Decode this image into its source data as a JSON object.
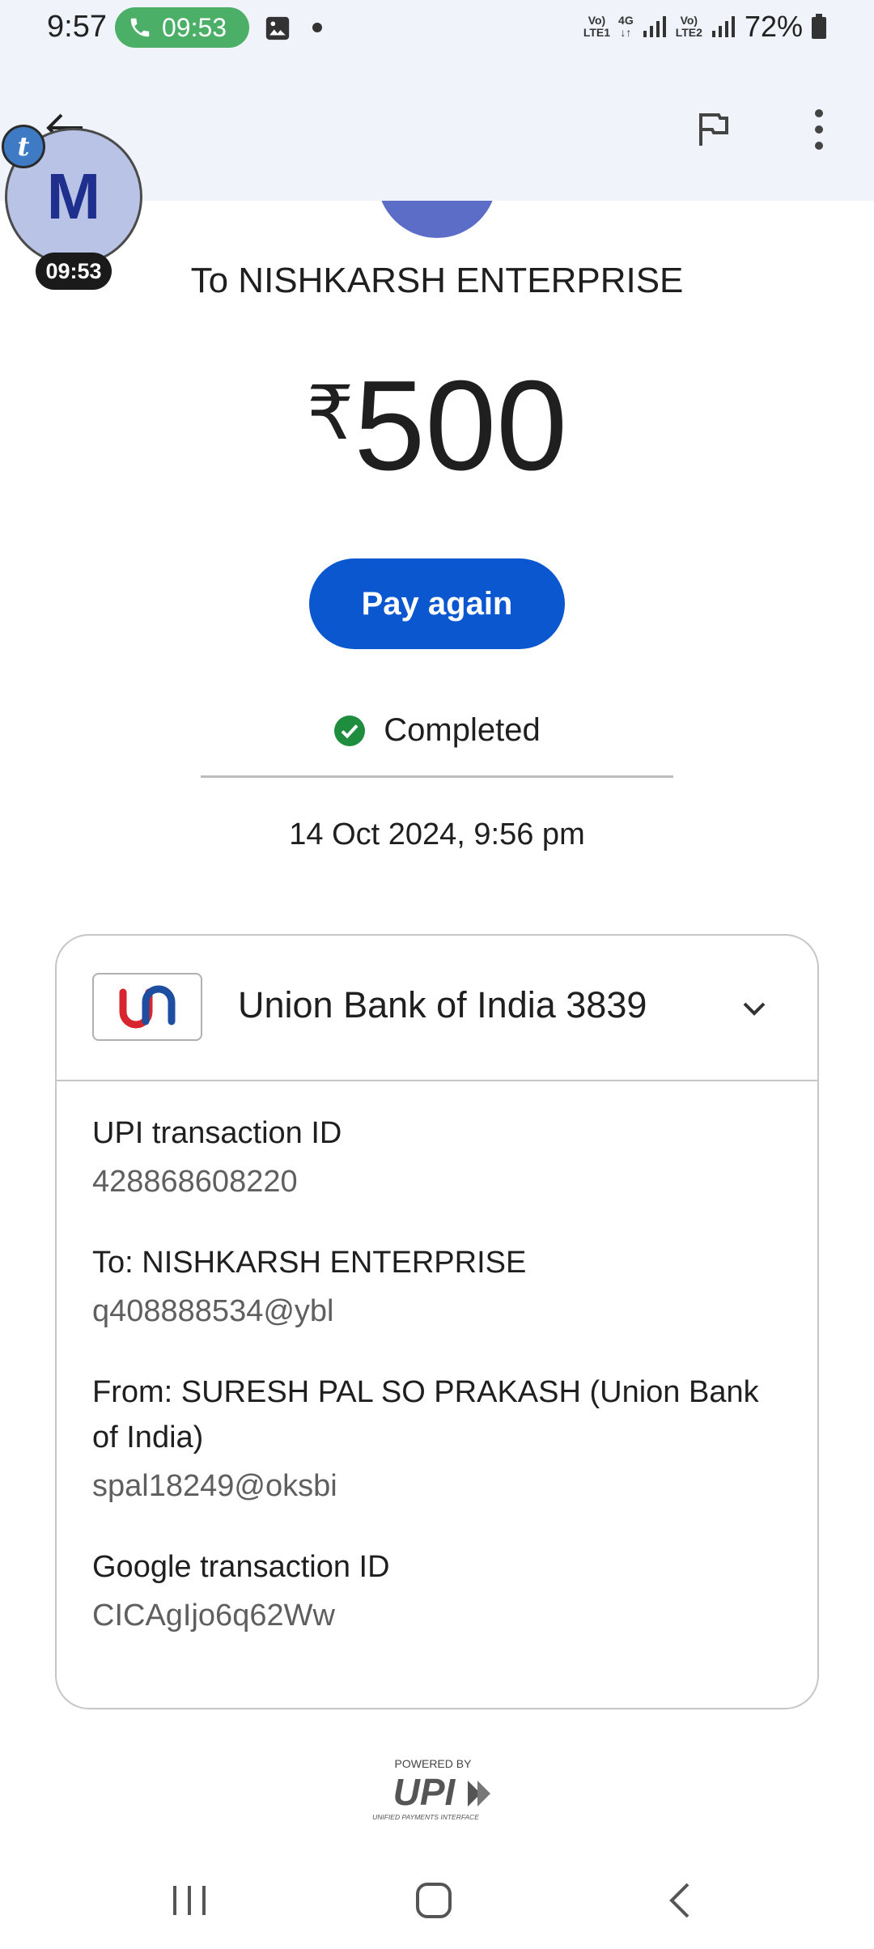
{
  "status_bar": {
    "time": "9:57",
    "call_timer": "09:53",
    "sim1_label_top": "Vo)",
    "sim1_label_bottom": "LTE1",
    "network_type": "4G",
    "sim2_label_top": "Vo)",
    "sim2_label_bottom": "LTE2",
    "battery": "72%"
  },
  "chat_head": {
    "initial": "M",
    "badge_letter": "t",
    "timer": "09:53"
  },
  "payment": {
    "to_line": "To NISHKARSH ENTERPRISE",
    "currency_symbol": "₹",
    "amount": "500",
    "pay_again_label": "Pay again",
    "status": "Completed",
    "datetime": "14 Oct 2024, 9:56 pm"
  },
  "card": {
    "bank_name": "Union Bank of India 3839",
    "details": [
      {
        "label": "UPI transaction ID",
        "value": "428868608220"
      },
      {
        "label": "To: NISHKARSH ENTERPRISE",
        "value": "q408888534@ybl"
      },
      {
        "label": "From: SURESH PAL SO PRAKASH (Union Bank of India)",
        "value": "spal18249@oksbi"
      },
      {
        "label": "Google transaction ID",
        "value": "CICAgIjo6q62Ww"
      }
    ]
  },
  "footer": {
    "powered_by": "POWERED BY",
    "upi_text": "UPI",
    "upi_subtext": "UNIFIED PAYMENTS INTERFACE"
  },
  "colors": {
    "primary_blue": "#0b57d0",
    "success_green": "#1e8e3e",
    "call_green": "#4caf68",
    "top_bar_bg": "#f0f4fa",
    "bank_red": "#d7262e",
    "bank_blue": "#1d4ea0"
  },
  "icons": {
    "back": "back-arrow-icon",
    "report": "flag-icon",
    "menu": "more-vert-icon",
    "status": "check-circle-icon",
    "expand": "chevron-down-icon"
  }
}
